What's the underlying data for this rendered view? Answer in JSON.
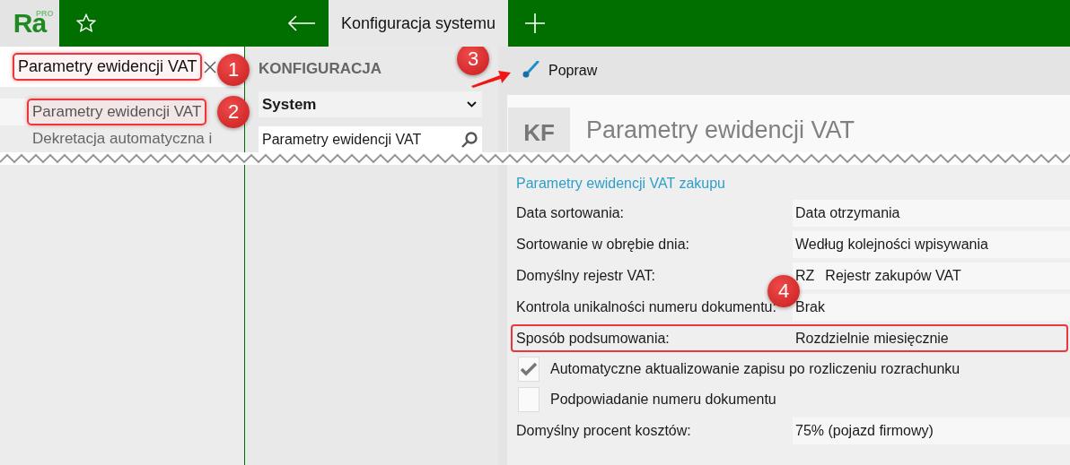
{
  "app": {
    "logo": "Ra",
    "logo_badge": "PRO"
  },
  "tabs": [
    {
      "label": "Konfiguracja systemu",
      "selected": true
    }
  ],
  "panel_tab": {
    "title": "Parametry ewidencji VAT",
    "highlighted": true,
    "callout": "1"
  },
  "sidebar": {
    "items": [
      {
        "label": "Parametry ewidencji VAT",
        "selected": true,
        "highlighted": true,
        "callout": "2"
      },
      {
        "label": "Dekretacja automatyczna i",
        "selected": false,
        "highlighted": false
      }
    ]
  },
  "config": {
    "heading": "KONFIGURACJA",
    "module": "System",
    "search": "Parametry ewidencji VAT"
  },
  "toolbar": {
    "buttons": [
      {
        "label": "Popraw",
        "callout": "3"
      }
    ]
  },
  "form": {
    "badge": "KF",
    "title": "Parametry ewidencji VAT",
    "section": "Parametry ewidencji VAT zakupu",
    "rows": [
      {
        "kind": "field",
        "label": "Data sortowania:",
        "value": "Data otrzymania",
        "highlighted": false
      },
      {
        "kind": "field",
        "label": "Sortowanie w obrębie dnia:",
        "value": "Według kolejności wpisywania",
        "highlighted": false
      },
      {
        "kind": "field",
        "label": "Domyślny rejestr VAT:",
        "code": "RZ",
        "value": "Rejestr zakupów VAT",
        "highlighted": false
      },
      {
        "kind": "field",
        "label": "Kontrola unikalności numeru dokumentu:",
        "value": "Brak",
        "highlighted": false,
        "callout": "4"
      },
      {
        "kind": "field",
        "label": "Sposób podsumowania:",
        "value": "Rozdzielnie miesięcznie",
        "highlighted": true
      },
      {
        "kind": "checkbox",
        "label": "Automatyczne aktualizowanie zapisu po rozliczeniu rozrachunku",
        "checked": true
      },
      {
        "kind": "checkbox",
        "label": "Podpowiadanie numeru dokumentu",
        "checked": false
      },
      {
        "kind": "field",
        "label": "Domyślny procent kosztów:",
        "value": "75% (pojazd firmowy)",
        "highlighted": false
      }
    ]
  }
}
